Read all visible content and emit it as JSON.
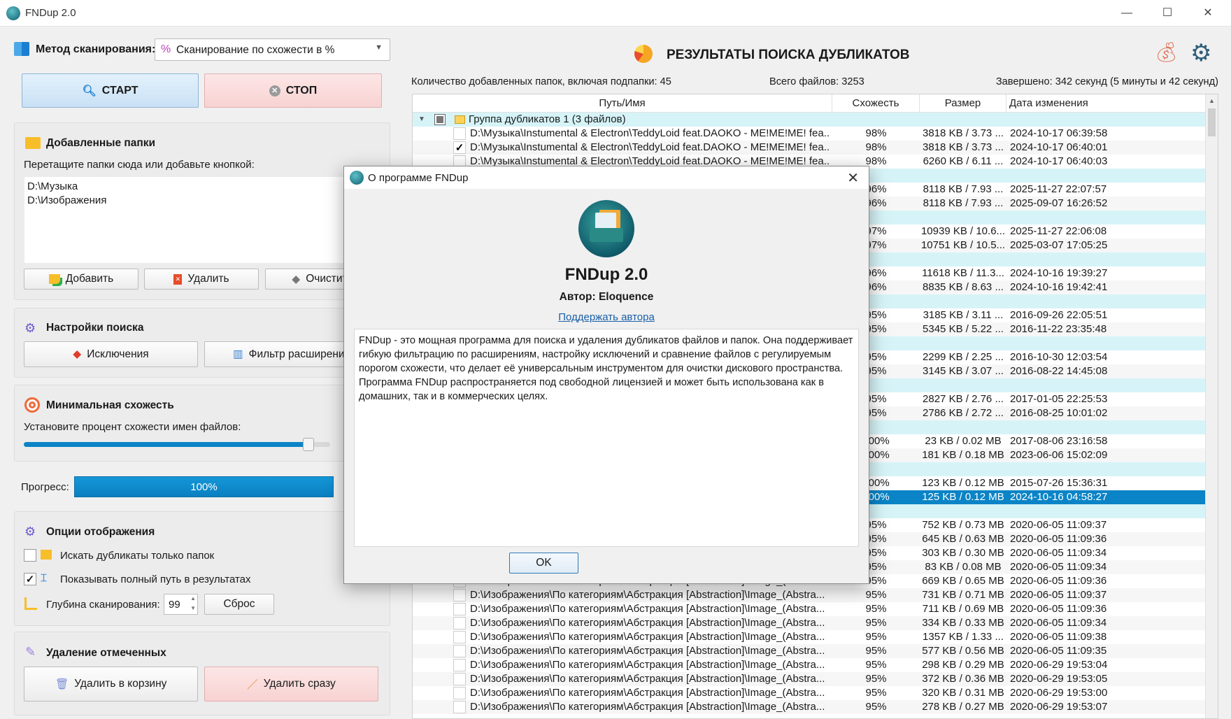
{
  "window": {
    "title": "FNDup 2.0",
    "minimize": "—",
    "maximize": "☐",
    "close": "✕"
  },
  "left": {
    "method_label": "Метод сканирования:",
    "method_value": "Сканирование по схожести в %",
    "method_icon": "%",
    "start": "СТАРТ",
    "stop": "СТОП",
    "folders": {
      "title": "Добавленные папки",
      "hint": "Перетащите папки сюда или добавьте кнопкой:",
      "items": [
        "D:\\Музыка",
        "D:\\Изображения"
      ],
      "add": "Добавить",
      "remove": "Удалить",
      "clear": "Очистить"
    },
    "search": {
      "title": "Настройки поиска",
      "exclusions": "Исключения",
      "ext_filter": "Фильтр расширений"
    },
    "similarity": {
      "title": "Минимальная схожесть",
      "label": "Установите процент схожести имен файлов:",
      "slider_percent": 93
    },
    "progress": {
      "label": "Прогресс:",
      "value": "100%",
      "percent": 100
    },
    "display": {
      "title": "Опции отображения",
      "only_folders": "Искать дубликаты только папок",
      "only_folders_checked": false,
      "full_path": "Показывать полный путь в результатах",
      "full_path_checked": true,
      "depth_label": "Глубина сканирования:",
      "depth_value": "99",
      "reset": "Сброс"
    },
    "delete": {
      "title": "Удаление отмеченных",
      "to_trash": "Удалить в корзину",
      "now": "Удалить сразу"
    }
  },
  "results": {
    "title": "РЕЗУЛЬТАТЫ ПОИСКА ДУБЛИКАТОВ",
    "stats_folders": "Количество добавленных папок, включая подпапки: 45",
    "stats_files": "Всего файлов: 3253",
    "stats_done": "Завершено: 342 секунд (5 минуты и 42 секунд)",
    "columns": [
      "Путь/Имя",
      "Схожесть",
      "Размер",
      "Дата изменения"
    ],
    "rows": [
      {
        "type": "group",
        "label": "Группа дубликатов 1 (3 файлов)"
      },
      {
        "type": "file",
        "path": "D:\\Музыка\\Instumental & Electron\\TeddyLoid feat.DAOKO - ME!ME!ME! fea...",
        "sim": "98%",
        "size": "3818 KB / 3.73 ...",
        "date": "2024-10-17 06:39:58",
        "checked": false
      },
      {
        "type": "file",
        "path": "D:\\Музыка\\Instumental & Electron\\TeddyLoid feat.DAOKO - ME!ME!ME! fea...",
        "sim": "98%",
        "size": "3818 KB / 3.73 ...",
        "date": "2024-10-17 06:40:01",
        "checked": true
      },
      {
        "type": "file",
        "path": "D:\\Музыка\\Instumental & Electron\\TeddyLoid feat.DAOKO - ME!ME!ME! fea...",
        "sim": "98%",
        "size": "6260 KB / 6.11 ...",
        "date": "2024-10-17 06:40:03",
        "checked": false
      },
      {
        "type": "group",
        "label": ""
      },
      {
        "type": "file",
        "path": "",
        "sim": "96%",
        "size": "8118 KB / 7.93 ...",
        "date": "2025-11-27 22:07:57"
      },
      {
        "type": "file",
        "path": "",
        "sim": "96%",
        "size": "8118 KB / 7.93 ...",
        "date": "2025-09-07 16:26:52"
      },
      {
        "type": "group",
        "label": ""
      },
      {
        "type": "file",
        "path": "",
        "sim": "97%",
        "size": "10939 KB / 10.6...",
        "date": "2025-11-27 22:06:08"
      },
      {
        "type": "file",
        "path": "",
        "sim": "97%",
        "size": "10751 KB / 10.5...",
        "date": "2025-03-07 17:05:25"
      },
      {
        "type": "group",
        "label": ""
      },
      {
        "type": "file",
        "path": "",
        "sim": "96%",
        "size": "11618 KB / 11.3...",
        "date": "2024-10-16 19:39:27"
      },
      {
        "type": "file",
        "path": "",
        "sim": "96%",
        "size": "8835 KB / 8.63 ...",
        "date": "2024-10-16 19:42:41"
      },
      {
        "type": "group",
        "label": ""
      },
      {
        "type": "file",
        "path": "",
        "sim": "95%",
        "size": "3185 KB / 3.11 ...",
        "date": "2016-09-26 22:05:51"
      },
      {
        "type": "file",
        "path": "",
        "sim": "95%",
        "size": "5345 KB / 5.22 ...",
        "date": "2016-11-22 23:35:48"
      },
      {
        "type": "group",
        "label": ""
      },
      {
        "type": "file",
        "path": "",
        "sim": "95%",
        "size": "2299 KB / 2.25 ...",
        "date": "2016-10-30 12:03:54"
      },
      {
        "type": "file",
        "path": "",
        "sim": "95%",
        "size": "3145 KB / 3.07 ...",
        "date": "2016-08-22 14:45:08"
      },
      {
        "type": "group",
        "label": ""
      },
      {
        "type": "file",
        "path": "",
        "sim": "95%",
        "size": "2827 KB / 2.76 ...",
        "date": "2017-01-05 22:25:53"
      },
      {
        "type": "file",
        "path": "",
        "sim": "95%",
        "size": "2786 KB / 2.72 ...",
        "date": "2016-08-25 10:01:02"
      },
      {
        "type": "group",
        "label": ""
      },
      {
        "type": "file",
        "path": "",
        "sim": "100%",
        "size": "23 KB / 0.02 MB",
        "date": "2017-08-06 23:16:58"
      },
      {
        "type": "file",
        "path": "",
        "sim": "100%",
        "size": "181 KB / 0.18 MB",
        "date": "2023-06-06 15:02:09"
      },
      {
        "type": "group",
        "label": ""
      },
      {
        "type": "file",
        "path": "",
        "sim": "100%",
        "size": "123 KB / 0.12 MB",
        "date": "2015-07-26 15:36:31"
      },
      {
        "type": "file",
        "path": "",
        "sim": "100%",
        "size": "125 KB / 0.12 MB",
        "date": "2024-10-16 04:58:27",
        "selected": true
      },
      {
        "type": "group",
        "label": ""
      },
      {
        "type": "file",
        "path": "",
        "sim": "95%",
        "size": "752 KB / 0.73 MB",
        "date": "2020-06-05 11:09:37"
      },
      {
        "type": "file",
        "path": "",
        "sim": "95%",
        "size": "645 KB / 0.63 MB",
        "date": "2020-06-05 11:09:36"
      },
      {
        "type": "file",
        "path": "",
        "sim": "95%",
        "size": "303 KB / 0.30 MB",
        "date": "2020-06-05 11:09:34"
      },
      {
        "type": "file",
        "path": "",
        "sim": "95%",
        "size": "83 KB / 0.08 MB",
        "date": "2020-06-05 11:09:34"
      },
      {
        "type": "file",
        "path": "D:\\Изображения\\По категориям\\Абстракция [Abstraction]\\Image_(Abstra...",
        "sim": "95%",
        "size": "669 KB / 0.65 MB",
        "date": "2020-06-05 11:09:36"
      },
      {
        "type": "file",
        "path": "D:\\Изображения\\По категориям\\Абстракция [Abstraction]\\Image_(Abstra...",
        "sim": "95%",
        "size": "731 KB / 0.71 MB",
        "date": "2020-06-05 11:09:37"
      },
      {
        "type": "file",
        "path": "D:\\Изображения\\По категориям\\Абстракция [Abstraction]\\Image_(Abstra...",
        "sim": "95%",
        "size": "711 KB / 0.69 MB",
        "date": "2020-06-05 11:09:36"
      },
      {
        "type": "file",
        "path": "D:\\Изображения\\По категориям\\Абстракция [Abstraction]\\Image_(Abstra...",
        "sim": "95%",
        "size": "334 KB / 0.33 MB",
        "date": "2020-06-05 11:09:34"
      },
      {
        "type": "file",
        "path": "D:\\Изображения\\По категориям\\Абстракция [Abstraction]\\Image_(Abstra...",
        "sim": "95%",
        "size": "1357 KB / 1.33 ...",
        "date": "2020-06-05 11:09:38"
      },
      {
        "type": "file",
        "path": "D:\\Изображения\\По категориям\\Абстракция [Abstraction]\\Image_(Abstra...",
        "sim": "95%",
        "size": "577 KB / 0.56 MB",
        "date": "2020-06-05 11:09:35"
      },
      {
        "type": "file",
        "path": "D:\\Изображения\\По категориям\\Абстракция [Abstraction]\\Image_(Abstra...",
        "sim": "95%",
        "size": "298 KB / 0.29 MB",
        "date": "2020-06-29 19:53:04"
      },
      {
        "type": "file",
        "path": "D:\\Изображения\\По категориям\\Абстракция [Abstraction]\\Image_(Abstra...",
        "sim": "95%",
        "size": "372 KB / 0.36 MB",
        "date": "2020-06-29 19:53:05"
      },
      {
        "type": "file",
        "path": "D:\\Изображения\\По категориям\\Абстракция [Abstraction]\\Image_(Abstra...",
        "sim": "95%",
        "size": "320 KB / 0.31 MB",
        "date": "2020-06-29 19:53:00"
      },
      {
        "type": "file",
        "path": "D:\\Изображения\\По категориям\\Абстракция [Abstraction]\\Image_(Abstra...",
        "sim": "95%",
        "size": "278 KB / 0.27 MB",
        "date": "2020-06-29 19:53:07"
      }
    ]
  },
  "about": {
    "title": "О программе FNDup",
    "app_name": "FNDup 2.0",
    "author": "Автор: Eloquence",
    "support_link": "Поддержать автора",
    "description": "FNDup - это мощная программа для поиска и удаления дубликатов файлов и папок. Она поддерживает гибкую фильтрацию по расширениям, настройку исключений и сравнение файлов с регулируемым порогом схожести, что делает её универсальным инструментом для очистки дискового пространства.",
    "license": "Программа FNDup распространяется под свободной лицензией и может быть использована как в домашних, так и в коммерческих целях.",
    "ok": "OK",
    "close": "✕"
  },
  "colors": {
    "accent": "#0a84c6",
    "group_row": "#d6f4f8",
    "start_bg": "#d7eaf9",
    "stop_bg": "#fbdcdc"
  }
}
